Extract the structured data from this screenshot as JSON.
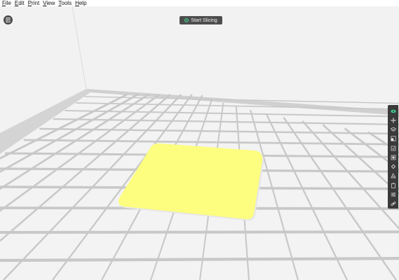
{
  "menu": [
    {
      "label": "File",
      "key": "F",
      "rest": "ile"
    },
    {
      "label": "Edit",
      "key": "E",
      "rest": "dit"
    },
    {
      "label": "Print",
      "key": "P",
      "rest": "rint"
    },
    {
      "label": "View",
      "key": "V",
      "rest": "iew"
    },
    {
      "label": "Tools",
      "key": "T",
      "rest": "ools"
    },
    {
      "label": "Help",
      "key": "H",
      "rest": "elp"
    }
  ],
  "slice_button": {
    "label": "Start Slicing",
    "icon": "slice-icon"
  },
  "toolbar": {
    "items": [
      {
        "name": "view-eye-icon",
        "active": true
      },
      {
        "name": "move-icon"
      },
      {
        "name": "layers-icon"
      },
      {
        "name": "scale-icon"
      },
      {
        "name": "rotate-icon"
      },
      {
        "name": "mirror-icon"
      },
      {
        "name": "support-icon"
      },
      {
        "name": "cut-icon"
      },
      {
        "name": "clipboard-icon"
      },
      {
        "name": "settings-icon"
      },
      {
        "name": "link-icon"
      }
    ]
  },
  "colors": {
    "model": "#fdfd80",
    "accent": "#3ecf8e",
    "toolbar": "#3a3a3a",
    "grid_line": "#c8c8c8"
  }
}
